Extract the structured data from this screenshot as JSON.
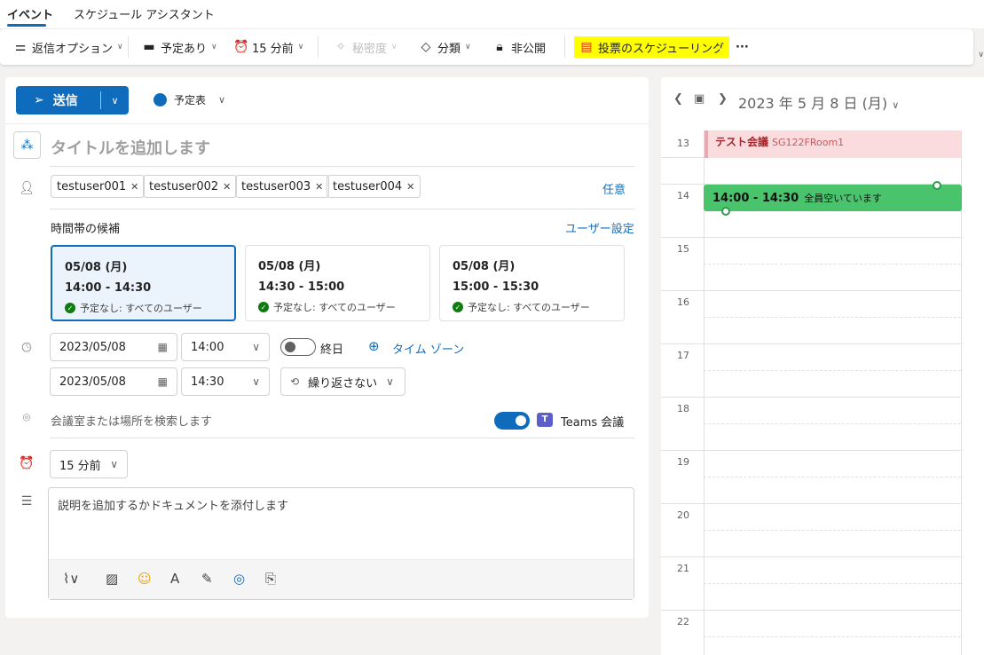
{
  "tabs": [
    "イベント",
    "スケジュール アシスタント"
  ],
  "toolbar": {
    "reply_options": "返信オプション",
    "busy": "予定あり",
    "reminder": "15 分前",
    "sensitivity": "秘密度",
    "category": "分類",
    "private": "非公開",
    "poll": "投票のスケジューリング",
    "more": "···"
  },
  "send": {
    "label": "送信"
  },
  "calendar_select": {
    "label": "予定表"
  },
  "title": {
    "placeholder": "タイトルを追加します"
  },
  "attendees": [
    "testuser001",
    "testuser002",
    "testuser003",
    "testuser004"
  ],
  "optional_link": "任意",
  "suggestions": {
    "label": "時間帯の候補",
    "settings_link": "ユーザー設定",
    "cards": [
      {
        "date": "05/08 (月)",
        "time": "14:00 - 14:30",
        "status": "予定なし: すべてのユーザー"
      },
      {
        "date": "05/08 (月)",
        "time": "14:30 - 15:00",
        "status": "予定なし: すべてのユーザー"
      },
      {
        "date": "05/08 (月)",
        "time": "15:00 - 15:30",
        "status": "予定なし: すべてのユーザー"
      }
    ]
  },
  "datetime": {
    "start_date": "2023/05/08",
    "start_time": "14:00",
    "end_date": "2023/05/08",
    "end_time": "14:30",
    "all_day": "終日",
    "timezone": "タイム ゾーン",
    "repeat": "繰り返さない"
  },
  "location": {
    "placeholder": "会議室または場所を検索します",
    "teams_label": "Teams 会議",
    "teams_on": true
  },
  "reminder": {
    "value": "15 分前"
  },
  "description": {
    "placeholder": "説明を追加するかドキュメントを添付します"
  },
  "calendar": {
    "date": "2023 年 5 月 8 日 (月)",
    "hours": [
      "13",
      "14",
      "15",
      "16",
      "17",
      "18",
      "19",
      "20",
      "21",
      "22"
    ],
    "events": [
      {
        "title": "テスト会議",
        "location": "SG122FRoom1"
      },
      {
        "title": "14:00 - 14:30",
        "subtitle": "全員空いています"
      }
    ]
  },
  "colors": {
    "accent": "#0f6cbd",
    "green_event": "#4ac36d",
    "red_event": "#fadcdf",
    "highlight": "#ffff00"
  }
}
